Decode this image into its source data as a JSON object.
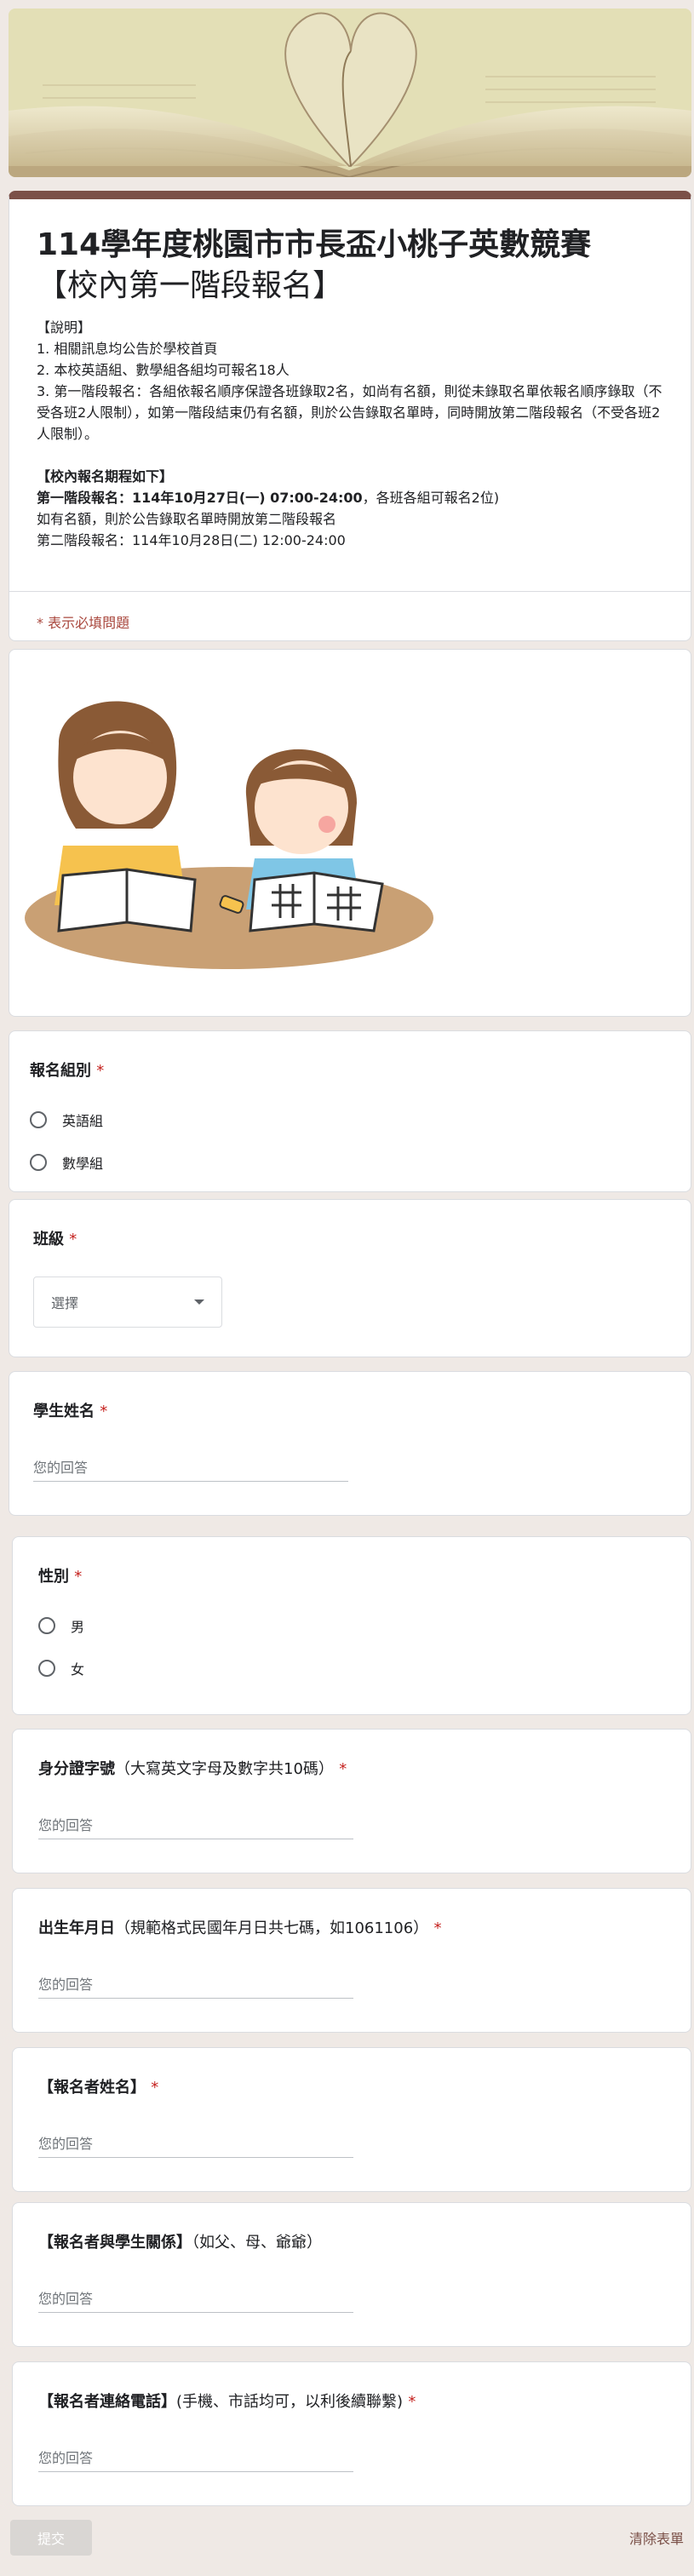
{
  "header": {
    "image": "open-book-heart-pages"
  },
  "form": {
    "title_main": "114學年度桃園市市長盃小桃子英數競賽",
    "title_sub": "【校內第一階段報名】",
    "desc_lines": [
      "【說明】",
      "1. 相關訊息均公告於學校首頁",
      "2. 本校英語組、數學組各組均可報名18人",
      "3. 第一階段報名：各組依報名順序保證各班錄取2名，如尚有名額，則從未錄取名單依報名順序錄取（不受各班2人限制），如第一階段結束仍有名額，則於公告錄取名單時，同時開放第二階段報名（不受各班2人限制）。"
    ],
    "schedule_title": "【校內報名期程如下】",
    "schedule_bold": "第一階段報名：114年10月27日(一) 07:00-24:00",
    "schedule_rest": "，各班各組可報名2位)",
    "schedule_line2": "如有名額，則於公告錄取名單時開放第二階段報名",
    "schedule_line3": "第二階段報名：114年10月28日(二) 12:00-24:00",
    "required_note": "* 表示必填問題"
  },
  "illustration": {
    "image": "two-children-studying"
  },
  "questions": {
    "group": {
      "label": "報名組別",
      "star": "*",
      "options": [
        "英語組",
        "數學組"
      ]
    },
    "class": {
      "label": "班級",
      "star": "*",
      "select_value": "選擇"
    },
    "student_name": {
      "label": "學生姓名",
      "star": "*",
      "placeholder": "您的回答"
    },
    "gender": {
      "label": "性別",
      "star": "*",
      "options": [
        "男",
        "女"
      ]
    },
    "id_number": {
      "label": "身分證字號",
      "hint": "（大寫英文字母及數字共10碼）",
      "star": "*",
      "placeholder": "您的回答"
    },
    "birthday": {
      "label": "出生年月日",
      "hint": "（規範格式民國年月日共七碼，如1061106）",
      "star": "*",
      "placeholder": "您的回答"
    },
    "applicant_name": {
      "label": "【報名者姓名】",
      "star": "*",
      "placeholder": "您的回答"
    },
    "relation": {
      "label": "【報名者與學生關係】",
      "hint": "（如父、母、爺爺）",
      "placeholder": "您的回答"
    },
    "phone": {
      "label": "【報名者連絡電話】",
      "hint": "(手機、市話均可，以利後續聯繫)",
      "star": "*",
      "placeholder": "您的回答"
    }
  },
  "footer": {
    "submit": "提交",
    "clear": "清除表單"
  },
  "colors": {
    "accent": "#7b5048",
    "required": "#c5221f",
    "background": "#efe9e5"
  }
}
